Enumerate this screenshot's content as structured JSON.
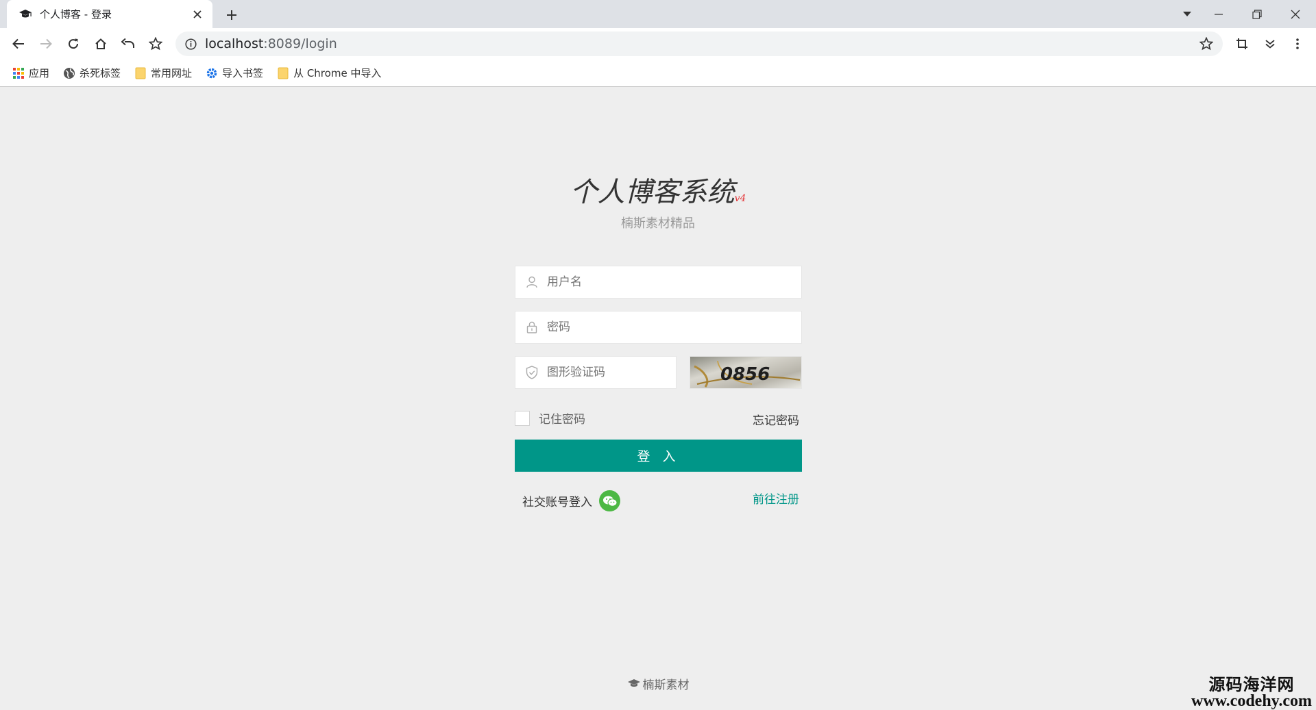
{
  "browser": {
    "tab_title": "个人博客 - 登录",
    "url_host": "localhost",
    "url_rest": ":8089/login",
    "bookmarks": [
      {
        "label": "应用",
        "icon": "apps-grid-icon"
      },
      {
        "label": "杀死标签",
        "icon": "globe-icon"
      },
      {
        "label": "常用网址",
        "icon": "folder-icon"
      },
      {
        "label": "导入书签",
        "icon": "gear-icon"
      },
      {
        "label": "从 Chrome 中导入",
        "icon": "folder-icon"
      }
    ]
  },
  "login": {
    "title": "个人博客系统",
    "version": "v4",
    "subtitle": "楠斯素材精品",
    "username_placeholder": "用户名",
    "password_placeholder": "密码",
    "captcha_placeholder": "图形验证码",
    "captcha_text": "0856",
    "remember_label": "记住密码",
    "forgot_label": "忘记密码",
    "login_button": "登 入",
    "social_label": "社交账号登入",
    "register_label": "前往注册"
  },
  "footer": {
    "text": "楠斯素材"
  },
  "watermark": {
    "line1": "源码海洋网",
    "line2": "www.codehy.com"
  },
  "colors": {
    "primary": "#009688",
    "version_red": "#e4393c",
    "wechat_green": "#4cb844",
    "page_bg": "#eeeeee"
  }
}
